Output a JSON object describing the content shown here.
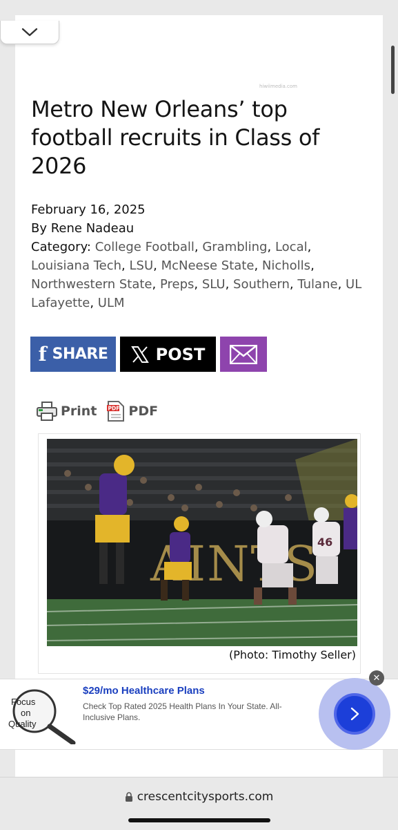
{
  "article": {
    "watermark": "hiwiimedia.com",
    "title": "Metro New Orleans’ top football recruits in Class of 2026",
    "date": "February 16, 2025",
    "author": "By Rene Nadeau",
    "category_label": "Category:",
    "categories": [
      "College Football",
      "Grambling",
      "Local",
      "Louisiana Tech",
      "LSU",
      "McNeese State",
      "Nicholls",
      "Northwestern State",
      "Preps",
      "SLU",
      "Southern",
      "Tulane",
      "UL Lafayette",
      "ULM"
    ]
  },
  "share": {
    "facebook_label": "SHARE",
    "x_label": "POST",
    "facebook_color": "#3b5fa8",
    "x_color": "#000000",
    "email_color": "#8e44ad"
  },
  "tools": {
    "print_label": "Print",
    "pdf_label": "PDF"
  },
  "photo": {
    "caption": "(Photo: Timothy Seller)"
  },
  "ad": {
    "logo_text": [
      "Focus",
      "on",
      "Quality"
    ],
    "title": "$29/mo Healthcare Plans",
    "description": "Check Top Rated 2025 Health Plans In Your State. All-Inclusive Plans.",
    "close_label": "✕",
    "accent_color": "#1c3fd9"
  },
  "browser": {
    "url": "crescentcitysports.com"
  }
}
